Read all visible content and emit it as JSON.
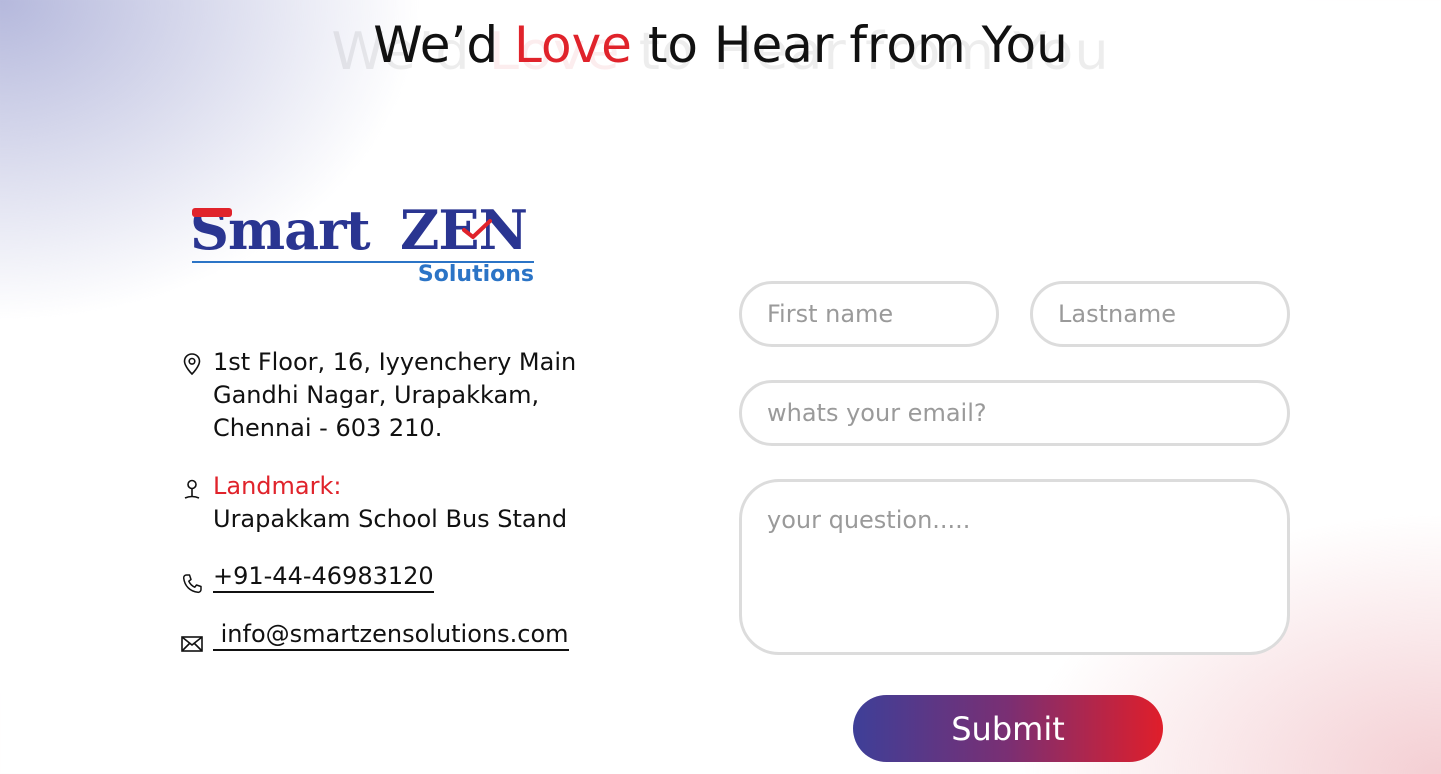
{
  "heading": {
    "before": "We’d ",
    "highlight": "Love",
    "after": " to Hear from You"
  },
  "logo": {
    "brand_part1": "Smart",
    "brand_part2": "ZEN",
    "tagline": "Solutions"
  },
  "contact": {
    "address_lines": [
      "1st Floor, 16, Iyyenchery Main",
      "Gandhi Nagar, Urapakkam,",
      "Chennai - 603 210."
    ],
    "landmark_label": "Landmark:",
    "landmark_value": "Urapakkam School Bus Stand",
    "phone": "+91-44-46983120",
    "email": " info@smartzensolutions.com"
  },
  "form": {
    "first_name_placeholder": "First name",
    "last_name_placeholder": "Lastname",
    "email_placeholder": "whats your email?",
    "question_placeholder": "your question.....",
    "submit_label": "Submit"
  },
  "colors": {
    "accent_red": "#e0232b",
    "brand_blue": "#2a3591",
    "sub_blue": "#2b74c6"
  },
  "icons": [
    "location-pin-icon",
    "landmark-icon",
    "phone-icon",
    "mail-icon"
  ]
}
